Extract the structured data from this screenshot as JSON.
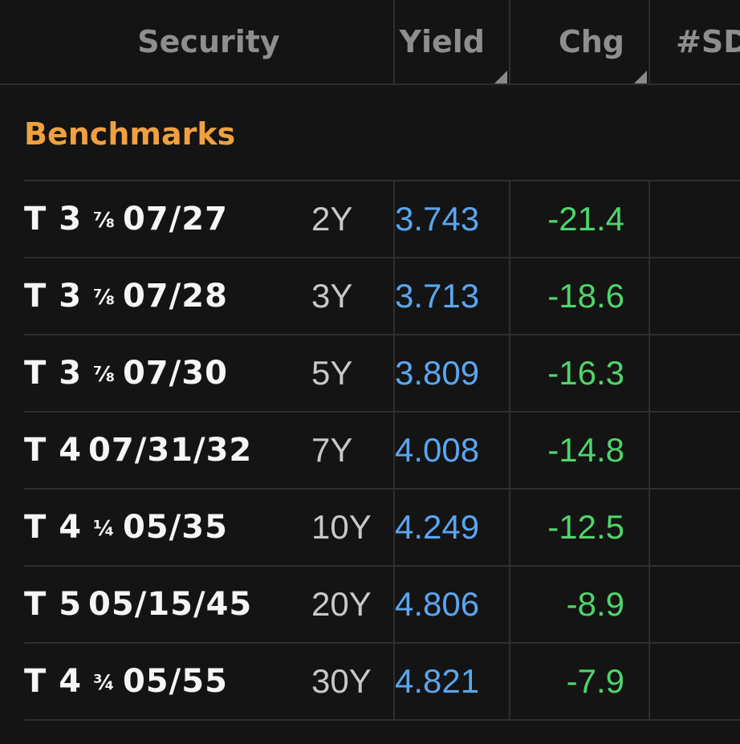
{
  "header": {
    "security": "Security",
    "yield": "Yield",
    "chg": "Chg",
    "sd": "#SD/"
  },
  "section_label": "Benchmarks",
  "rows": [
    {
      "prefix": "T 3",
      "frac": "⅞",
      "date": "07/27",
      "tenor": "2Y",
      "yield": "3.743",
      "chg": "-21.4"
    },
    {
      "prefix": "T 3",
      "frac": "⅞",
      "date": "07/28",
      "tenor": "3Y",
      "yield": "3.713",
      "chg": "-18.6"
    },
    {
      "prefix": "T 3",
      "frac": "⅞",
      "date": "07/30",
      "tenor": "5Y",
      "yield": "3.809",
      "chg": "-16.3"
    },
    {
      "prefix": "T 4",
      "frac": "",
      "date": "07/31/32",
      "tenor": "7Y",
      "yield": "4.008",
      "chg": "-14.8"
    },
    {
      "prefix": "T 4",
      "frac": "¼",
      "date": "05/35",
      "tenor": "10Y",
      "yield": "4.249",
      "chg": "-12.5"
    },
    {
      "prefix": "T 5",
      "frac": "",
      "date": "05/15/45",
      "tenor": "20Y",
      "yield": "4.806",
      "chg": "-8.9"
    },
    {
      "prefix": "T 4",
      "frac": "¾",
      "date": "05/55",
      "tenor": "30Y",
      "yield": "4.821",
      "chg": "-7.9"
    }
  ],
  "colors": {
    "background": "#141414",
    "header_text": "#8e8e8e",
    "section": "#f0a040",
    "yield": "#5aa6f0",
    "chg_negative": "#4fd56a",
    "grid": "#2e2e2e"
  }
}
